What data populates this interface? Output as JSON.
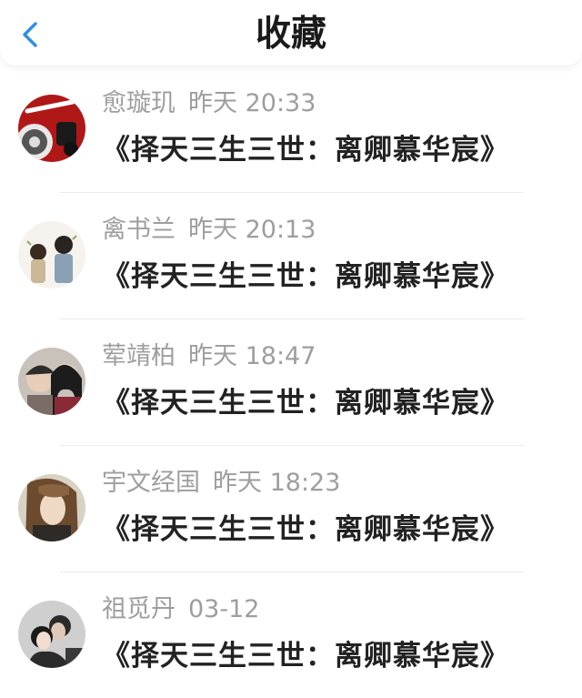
{
  "header": {
    "title": "收藏",
    "back_icon": "chevron-left-icon",
    "accent": "#2f8de4"
  },
  "favorites": [
    {
      "name": "愈璇玑",
      "time": "昨天 20:33",
      "text": "《择天三生三世：离卿慕华宸》"
    },
    {
      "name": "禽书兰",
      "time": "昨天 20:13",
      "text": "《择天三生三世：离卿慕华宸》"
    },
    {
      "name": "荤靖柏",
      "time": "昨天 18:47",
      "text": "《择天三生三世：离卿慕华宸》"
    },
    {
      "name": "宇文经国",
      "time": "昨天 18:23",
      "text": "《择天三生三世：离卿慕华宸》"
    },
    {
      "name": "祖觅丹",
      "time": "03-12",
      "text": "《择天三生三世：离卿慕华宸》"
    }
  ]
}
